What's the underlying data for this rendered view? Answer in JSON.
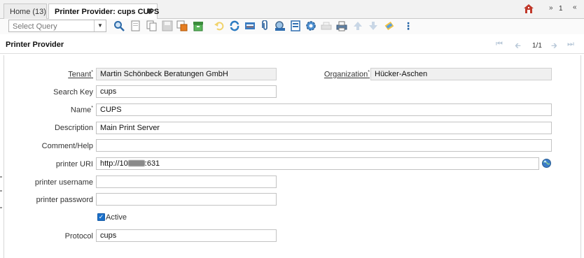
{
  "tabs": [
    {
      "label": "Home (13)"
    },
    {
      "label": "Printer Provider: cups CUPS",
      "close": "✖"
    }
  ],
  "tabbar": {
    "open_count": "1"
  },
  "toolbar": {
    "query_placeholder": "Select Query",
    "icons": [
      "search-icon",
      "new-record-icon",
      "copy-record-icon",
      "save-icon",
      "save-new-icon",
      "archive-icon",
      "undo-icon",
      "refresh-icon",
      "grid-toggle-icon",
      "attachment-icon",
      "zoom-icon",
      "report-icon",
      "process-icon",
      "print-preview-icon",
      "print-icon",
      "up-icon",
      "down-icon",
      "help-icon"
    ]
  },
  "window": {
    "title": "Printer Provider",
    "record_nav": "1/1"
  },
  "form": {
    "tenant": {
      "label": "Tenant",
      "value": "Martin Schönbeck Beratungen GmbH"
    },
    "organization": {
      "label": "Organization",
      "value": "Hücker-Aschen"
    },
    "search_key": {
      "label": "Search Key",
      "value": "cups"
    },
    "name": {
      "label": "Name",
      "value": "CUPS"
    },
    "description": {
      "label": "Description",
      "value": "Main Print Server"
    },
    "comment_help": {
      "label": "Comment/Help",
      "value": ""
    },
    "printer_uri": {
      "label": "printer URI",
      "value_prefix": "http://10",
      "value_suffix": ":631"
    },
    "printer_username": {
      "label": "printer username",
      "value": ""
    },
    "printer_password": {
      "label": "printer password",
      "value": ""
    },
    "active": {
      "label": "Active",
      "checked": true
    },
    "protocol": {
      "label": "Protocol",
      "value": "cups"
    }
  },
  "colors": {
    "accent": "#1a6fc9",
    "mandatory_marker": "#555555"
  }
}
